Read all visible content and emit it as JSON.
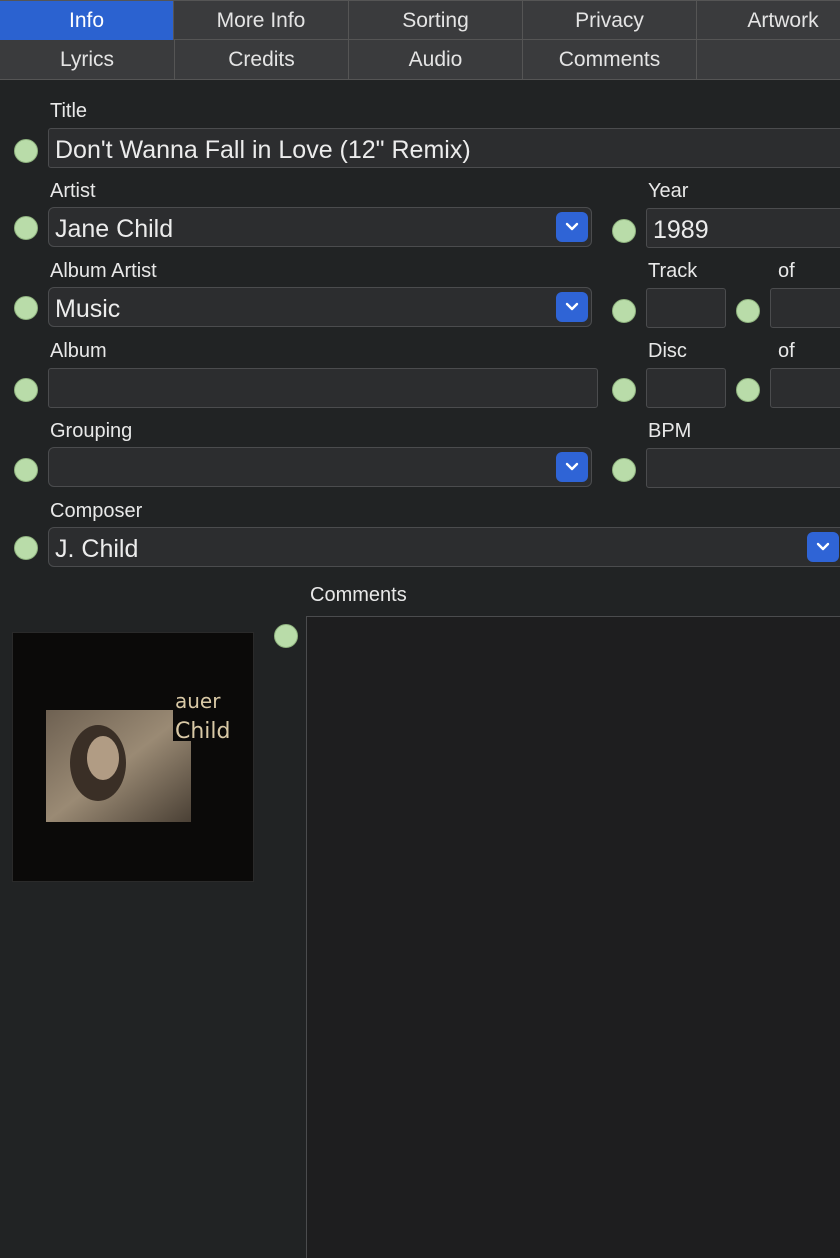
{
  "tabs_row1": [
    {
      "label": "Info",
      "active": true
    },
    {
      "label": "More Info",
      "active": false
    },
    {
      "label": "Sorting",
      "active": false
    },
    {
      "label": "Privacy",
      "active": false
    },
    {
      "label": "Artwork",
      "active": false
    }
  ],
  "tabs_row2": [
    {
      "label": "Lyrics"
    },
    {
      "label": "Credits"
    },
    {
      "label": "Audio"
    },
    {
      "label": "Comments"
    },
    {
      "label": ""
    }
  ],
  "fields": {
    "title": {
      "label": "Title",
      "value": "Don't Wanna Fall in Love (12\" Remix)"
    },
    "artist": {
      "label": "Artist",
      "value": "Jane Child"
    },
    "year": {
      "label": "Year",
      "value": "1989"
    },
    "album_artist": {
      "label": "Album Artist",
      "value": "Music"
    },
    "track": {
      "label": "Track",
      "value": "",
      "of_label": "of",
      "of_value": ""
    },
    "album": {
      "label": "Album",
      "value": ""
    },
    "disc": {
      "label": "Disc",
      "value": "",
      "of_label": "of",
      "of_value": ""
    },
    "grouping": {
      "label": "Grouping",
      "value": ""
    },
    "bpm": {
      "label": "BPM",
      "value": ""
    },
    "composer": {
      "label": "Composer",
      "value": "J. Child"
    },
    "comments": {
      "label": "Comments",
      "value": ""
    }
  },
  "artwork": {
    "alt": "album artwork"
  },
  "colors": {
    "accent": "#2b62d0",
    "indicator": "#b9dca9",
    "background": "#212324",
    "field_bg": "#2c2d2f"
  },
  "icons": {
    "dropdown": "chevron-down-icon",
    "status": "status-dot-icon"
  }
}
